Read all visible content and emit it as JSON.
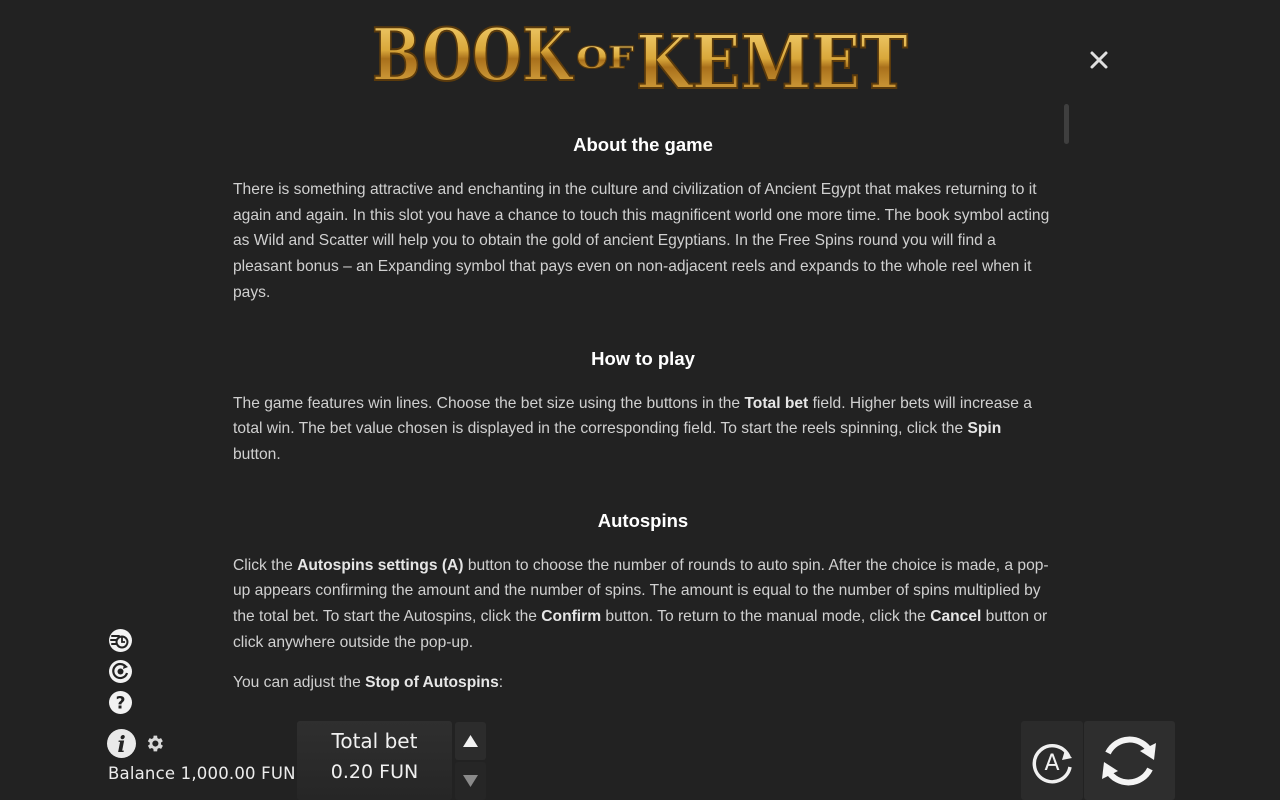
{
  "logo": {
    "word1": "BOOK",
    "word2": "OF",
    "word3": "KEMET"
  },
  "icons": {
    "close": "close-icon",
    "turbo": "turbo-spin-icon",
    "sound": "sound-icon",
    "help": "help-icon",
    "info": "info-icon",
    "settings": "gear-icon",
    "bet_up": "triangle-up-icon",
    "bet_down": "triangle-down-icon",
    "autospin": "autospin-icon",
    "spin": "spin-icon"
  },
  "sections": {
    "about": {
      "title": "About the game",
      "text": "There is something attractive and enchanting in the culture and civilization of Ancient Egypt that makes returning to it again and again. In this slot you have a chance to touch this magnificent world one more time. The book symbol acting as Wild and Scatter will help you to obtain the gold of ancient Egyptians. In the Free Spins round you will find a pleasant bonus – an Expanding symbol that pays even on non-adjacent reels and expands to the whole reel when it pays."
    },
    "howto": {
      "title": "How to play",
      "t1": "The game features win lines. Choose the bet size using the buttons in the ",
      "b1": "Total bet",
      "t2": " field. Higher bets will increase a total win. The bet value chosen is displayed in the corresponding field. To start the reels spinning, click the ",
      "b2": "Spin",
      "t3": " button."
    },
    "autospins": {
      "title": "Autospins",
      "t1": "Click the ",
      "b1": "Autospins settings (A)",
      "t2": " button to choose the number of rounds to auto spin. After the choice is made, a pop-up appears confirming the amount and the number of spins. The amount is equal to the number of spins multiplied by the total bet. To start the Autospins, click the ",
      "b2": "Confirm",
      "t3": " button. To return to the manual mode, click the ",
      "b3": "Cancel",
      "t4": " button or click anywhere outside the pop-up.",
      "p2_t1": "You can adjust the ",
      "p2_b1": "Stop of Autospins",
      "p2_t2": ":"
    }
  },
  "footer": {
    "balance": "Balance 1,000.00 FUN",
    "bet_label": "Total bet",
    "bet_value": "0.20 FUN",
    "autospin_letter": "A"
  },
  "colors": {
    "background": "#222222",
    "logo_gold": "#d9a73a",
    "text": "#d0d0d0",
    "heading": "#ffffff"
  }
}
